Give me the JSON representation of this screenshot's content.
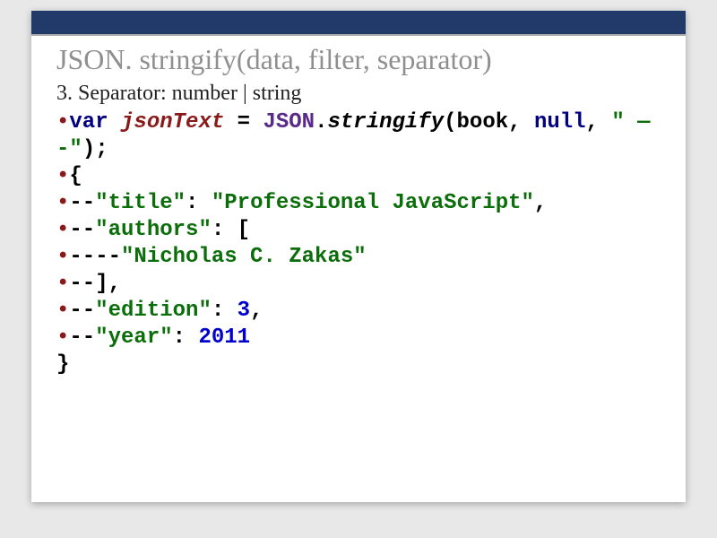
{
  "title": "JSON. stringify(data, filter, separator)",
  "subline": "3. Separator: number | string",
  "bullet": "•",
  "code": {
    "l1": {
      "kw_var": "var",
      "sp1": " ",
      "varname": "jsonText",
      "sp2": " ",
      "eq": "=",
      "sp3": " ",
      "cls": "JSON",
      "dot": ".",
      "fn": "stringify",
      "open": "(",
      "arg1": "book",
      "comma1": ",",
      "sp4": " "
    },
    "l1b": {
      "kw_null": "null",
      "comma2": ",",
      "sp5": " ",
      "str": "\" — -\"",
      "close": ")",
      "semi": ";"
    },
    "l2": {
      "brace": "{"
    },
    "l3": {
      "dash": "--",
      "key": "\"title\"",
      "colon": ":",
      "sp": " ",
      "val": "\"Professional JavaScript\"",
      "comma": ","
    },
    "l4": {
      "dash": "--",
      "key": "\"authors\"",
      "colon": ":",
      "sp": " ",
      "bracket": "["
    },
    "l5": {
      "dash": "----",
      "val": "\"Nicholas C. Zakas\""
    },
    "l6": {
      "dash": "--",
      "bracket": "]",
      "comma": ","
    },
    "l7": {
      "dash": "--",
      "key": "\"edition\"",
      "colon": ":",
      "sp": " ",
      "val": "3",
      "comma": ","
    },
    "l8": {
      "dash": "--",
      "key": "\"year\"",
      "colon": ":",
      "sp": " ",
      "val": "2011"
    },
    "l9": {
      "brace": "}"
    }
  }
}
